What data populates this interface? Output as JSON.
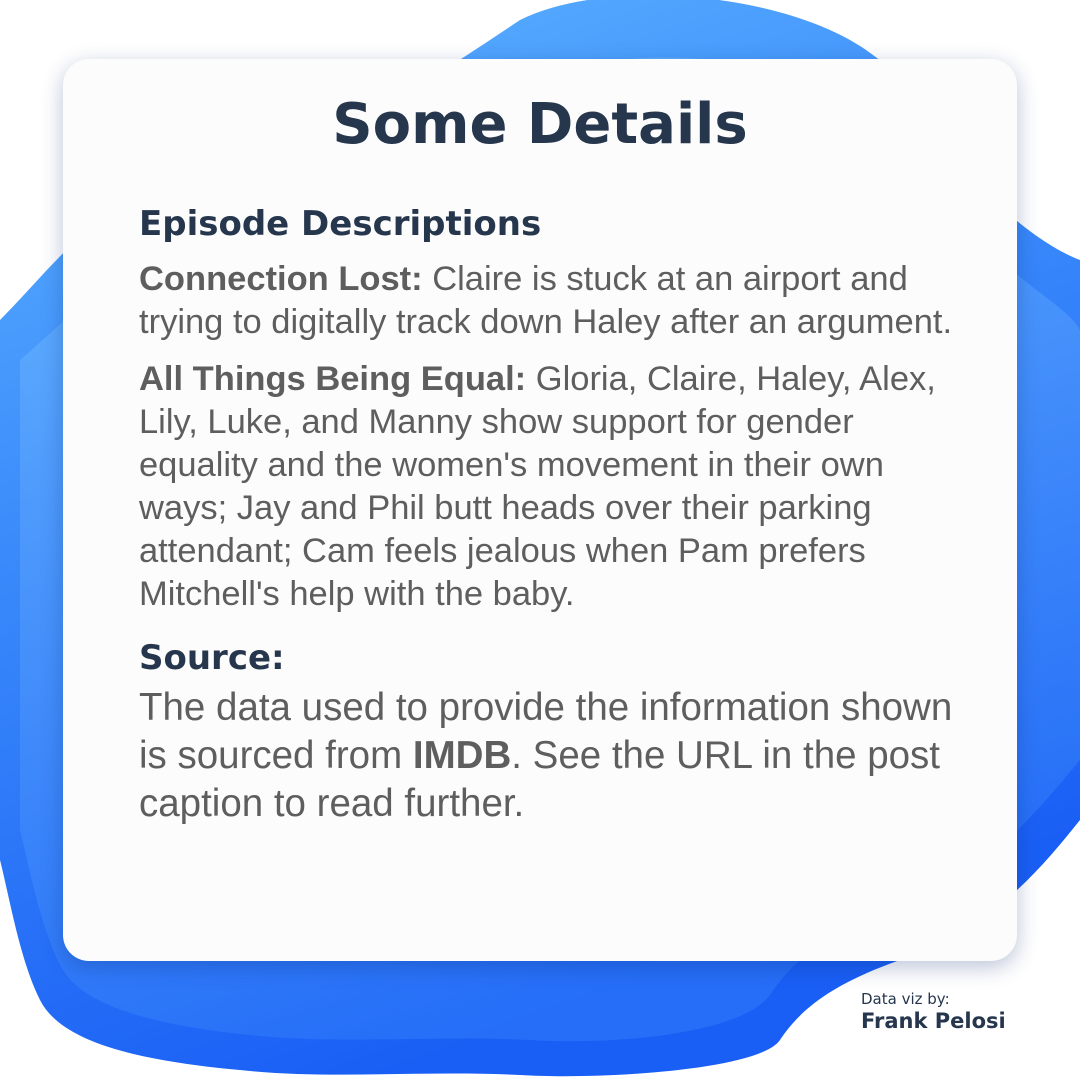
{
  "page": {
    "title": "Some Details"
  },
  "episodes_section": {
    "heading": "Episode Descriptions",
    "items": [
      {
        "name": "Connection Lost:",
        "description": " Claire is stuck at an airport and trying to digitally track down Haley after an argument."
      },
      {
        "name": "All Things Being Equal:",
        "description": " Gloria, Claire, Haley, Alex, Lily, Luke, and Manny show support for gender equality and the women's movement in their own ways; Jay and Phil butt heads over their parking attendant; Cam feels jealous when Pam prefers Mitchell's help with the baby."
      }
    ]
  },
  "source_section": {
    "heading": "Source:",
    "text_before": "The data used to provide the information shown is sourced from ",
    "highlight": "IMDB",
    "text_after": ". See the URL in the post caption to read further."
  },
  "credit": {
    "line1": "Data viz by:",
    "line2": "Frank Pelosi"
  },
  "colors": {
    "heading": "#25364d",
    "body_text": "#5e5e5e",
    "card": "#fcfcfc",
    "blob_light": "#5fb6ff",
    "blob_dark": "#1a63f5"
  }
}
